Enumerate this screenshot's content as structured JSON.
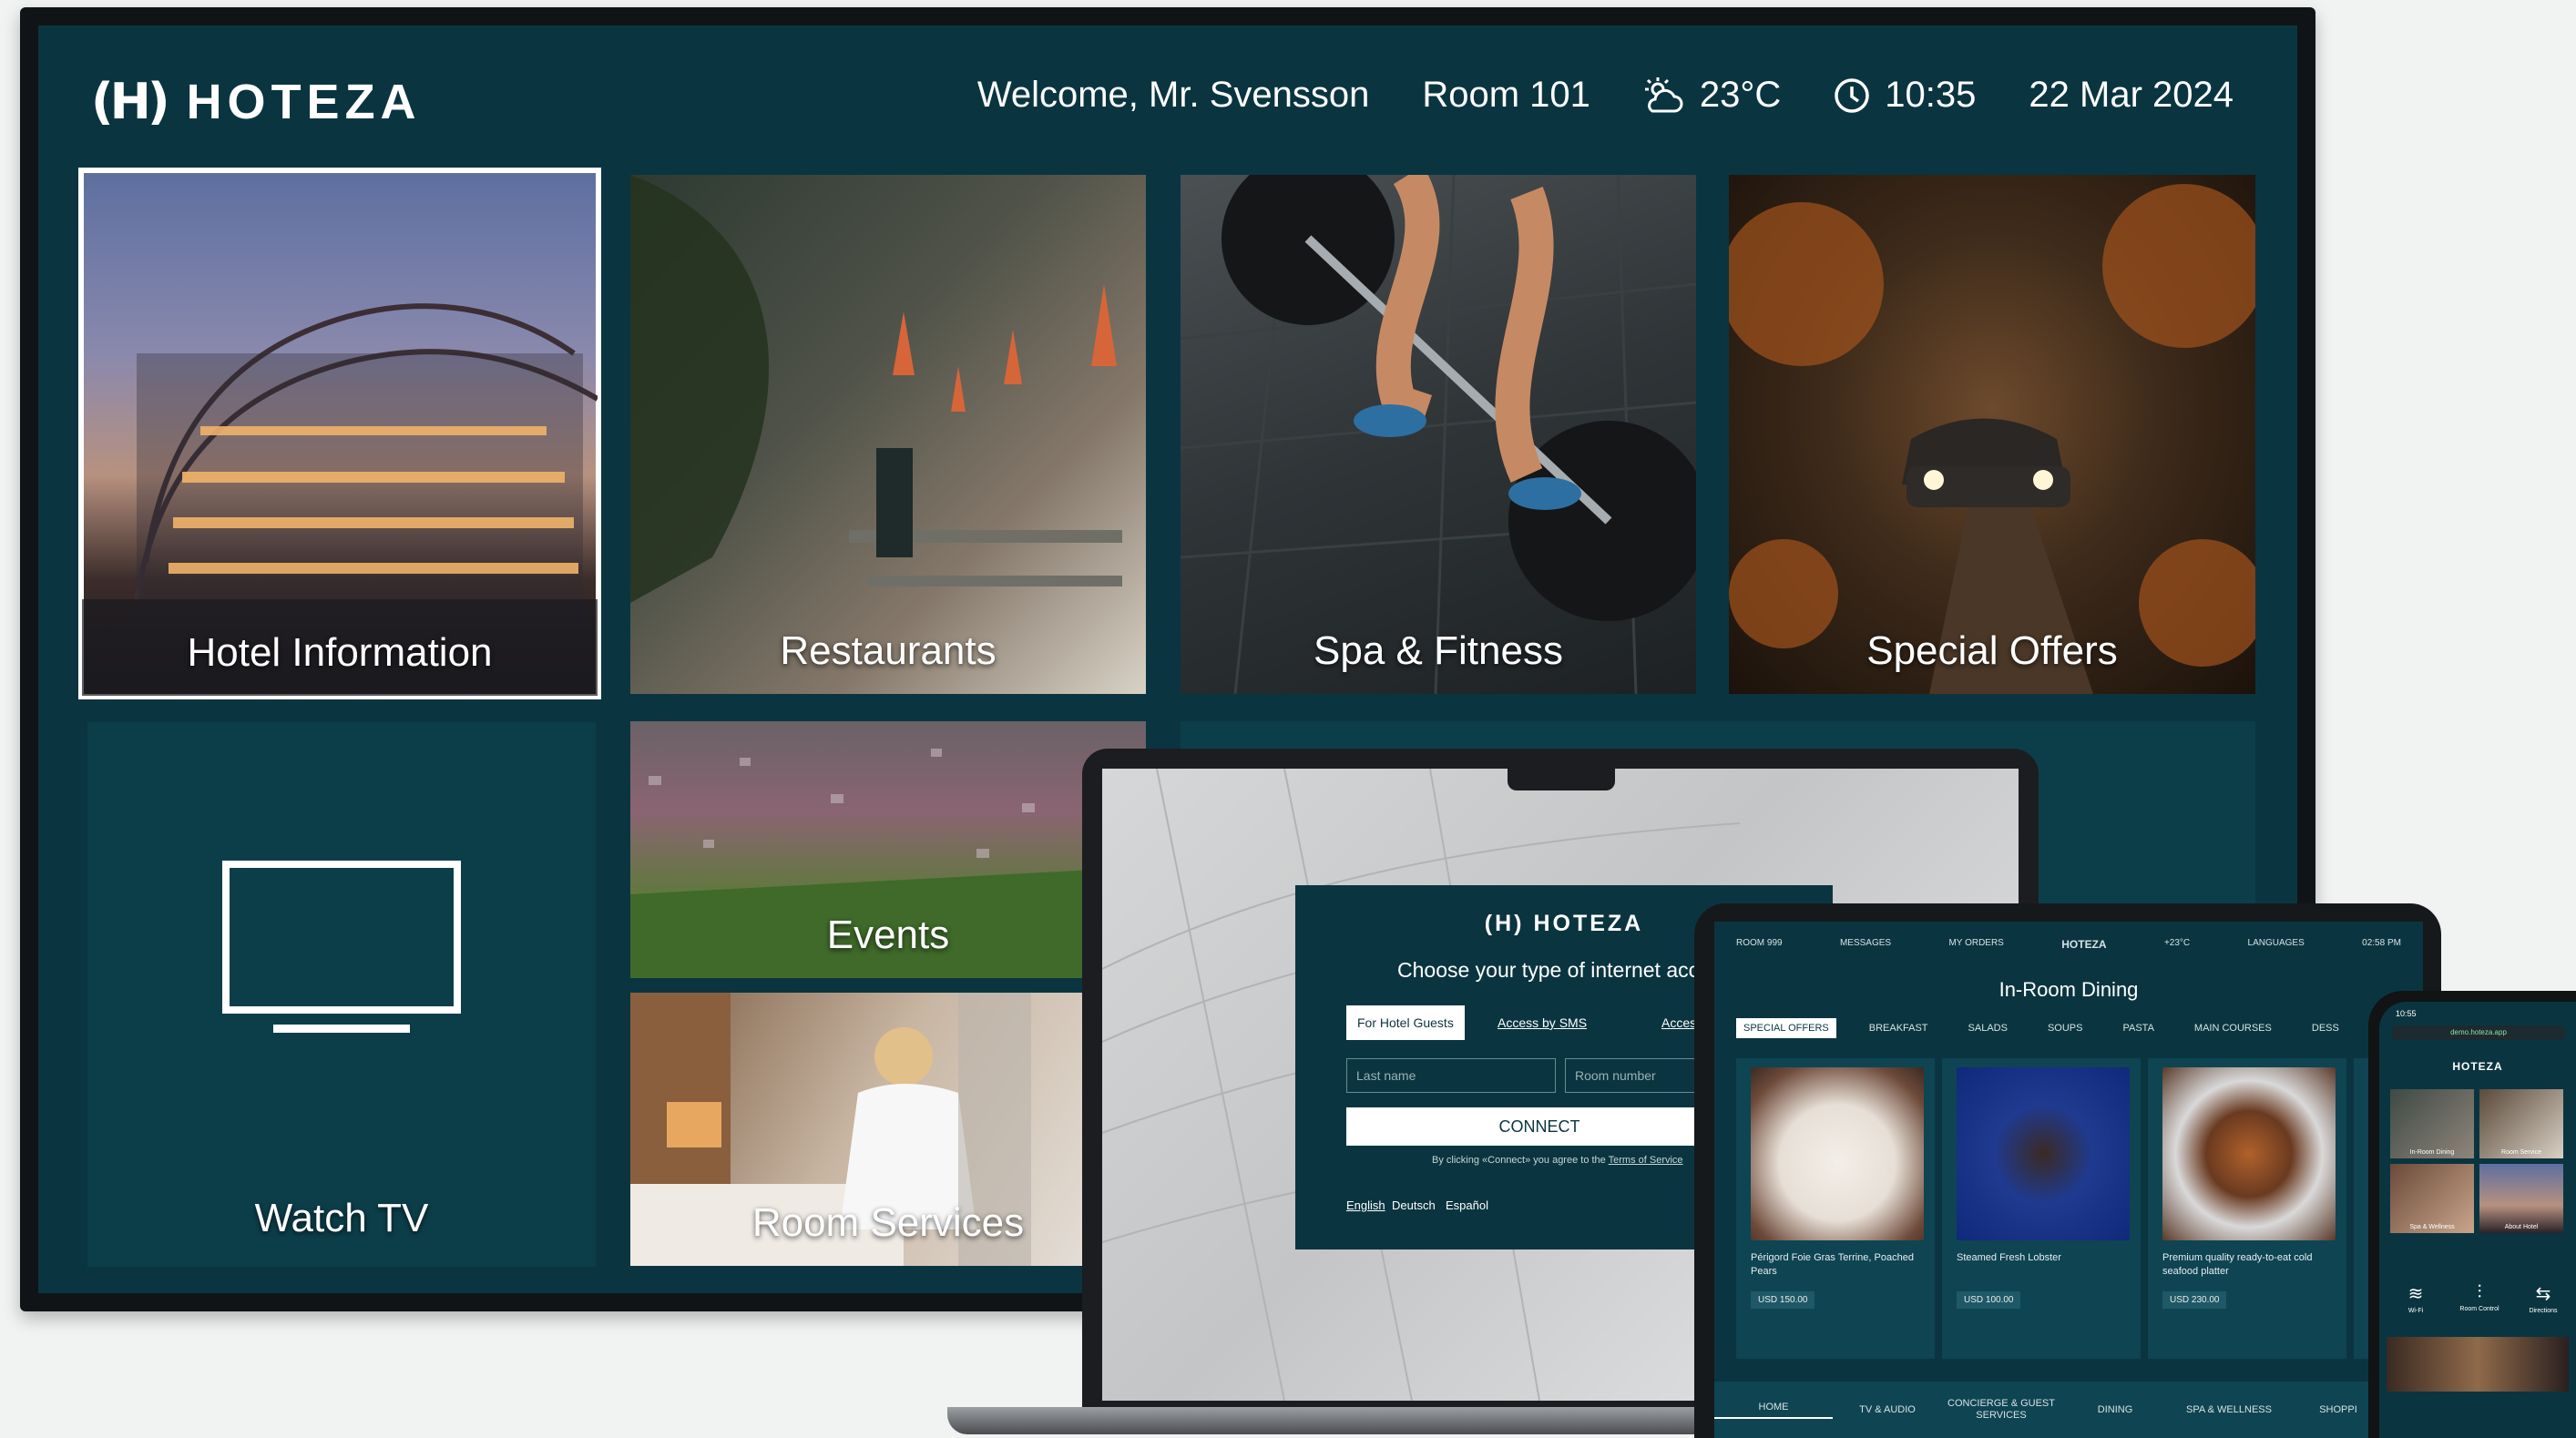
{
  "tv": {
    "logo": "HOTEZA",
    "logo_mark": "(H)",
    "welcome": "Welcome, Mr. Svensson",
    "room": "Room 101",
    "weather": "23°C",
    "time": "10:35",
    "date": "22 Mar 2024",
    "tiles": {
      "hotel_information": "Hotel Information",
      "restaurants": "Restaurants",
      "spa_fitness": "Spa & Fitness",
      "special_offers": "Special Offers",
      "watch_tv": "Watch TV",
      "events": "Events",
      "room_services": "Room Services"
    }
  },
  "laptop": {
    "logo": "HOTEZA",
    "title": "Choose your type of internet acc",
    "tabs": [
      "For Hotel Guests",
      "Access by SMS",
      "Access"
    ],
    "lastname_placeholder": "Last name",
    "room_placeholder": "Room number",
    "connect": "CONNECT",
    "terms_text": "By clicking «Connect» you agree to the",
    "terms_link": "Terms of Service",
    "languages": [
      "English",
      "Deutsch",
      "Español"
    ]
  },
  "tablet": {
    "status": [
      "ROOM 999",
      "MESSAGES",
      "MY ORDERS",
      "HOTEZA",
      "+23°C",
      "LANGUAGES",
      "02:58 PM"
    ],
    "title": "In-Room Dining",
    "categories": [
      "SPECIAL OFFERS",
      "BREAKFAST",
      "SALADS",
      "SOUPS",
      "PASTA",
      "MAIN COURSES",
      "DESS"
    ],
    "dishes": [
      {
        "name": "Périgord Foie Gras Terrine, Poached Pears",
        "price": "USD 150.00"
      },
      {
        "name": "Steamed Fresh Lobster",
        "price": "USD 100.00"
      },
      {
        "name": "Premium quality ready-to-eat cold seafood platter",
        "price": "USD 230.00"
      }
    ],
    "nav": [
      "HOME",
      "TV & AUDIO",
      "CONCIERGE & GUEST SERVICES",
      "DINING",
      "SPA & WELLNESS",
      "SHOPPI"
    ]
  },
  "phone": {
    "time": "10:55",
    "url": "demo.hoteza.app",
    "logo": "HOTEZA",
    "tiles": [
      "In-Room Dining",
      "Room Service",
      "Spa & Wellness",
      "About Hotel"
    ],
    "icons": [
      "Wi-Fi",
      "Room Control",
      "Directions"
    ]
  },
  "colors": {
    "teal": "#0a3540",
    "teal_panel": "#0f4452",
    "white": "#ffffff"
  }
}
